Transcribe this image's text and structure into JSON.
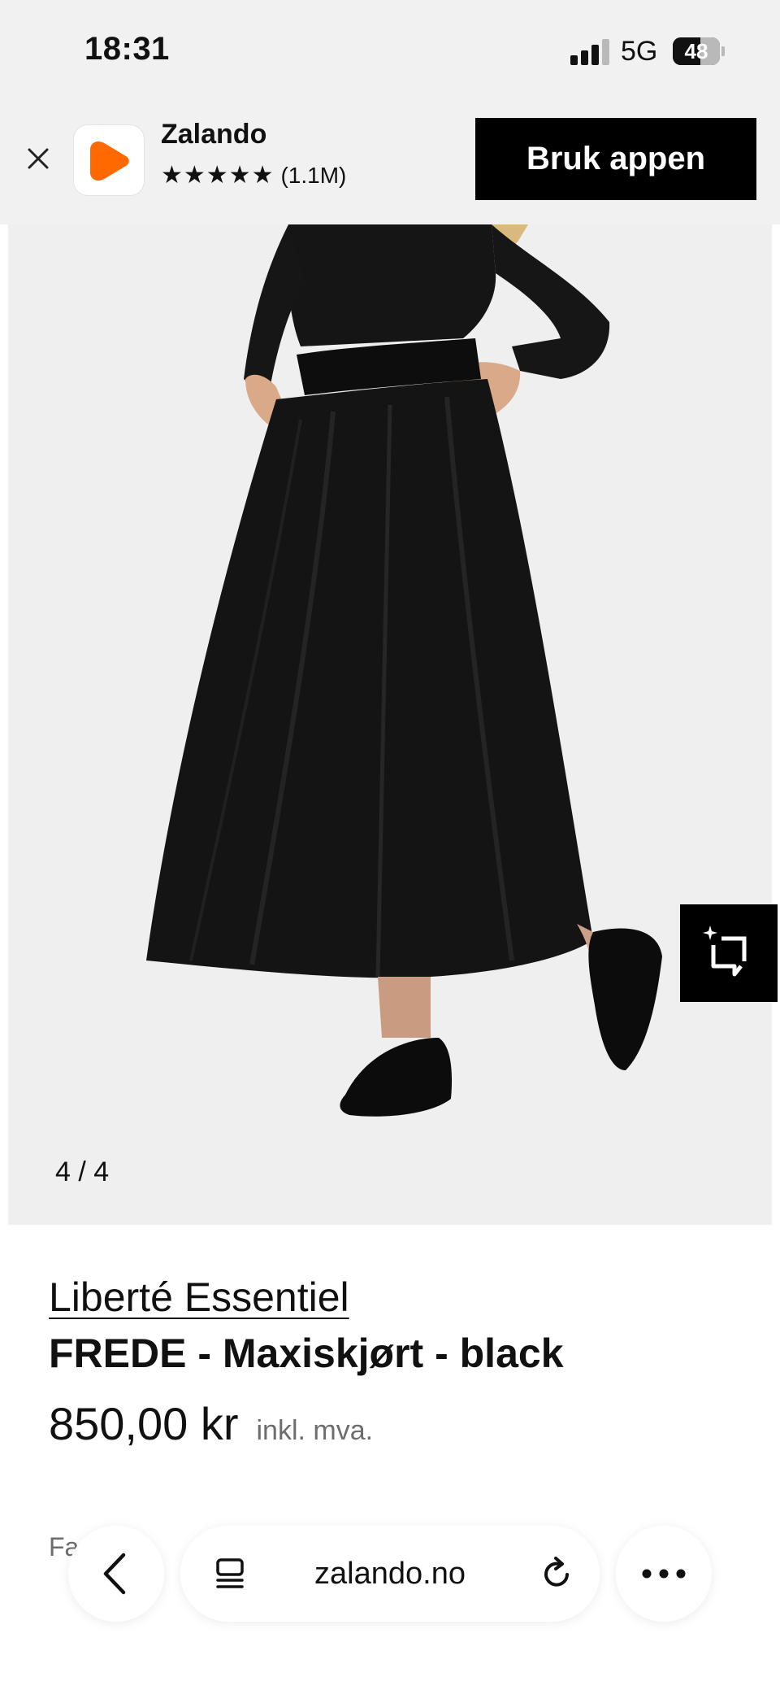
{
  "status_bar": {
    "time": "18:31",
    "network": "5G",
    "battery": "48",
    "battery_level_percent": 48
  },
  "app_banner": {
    "app_name": "Zalando",
    "stars": "★★★★★",
    "rating_count": "(1.1M)",
    "cta_label": "Bruk appen",
    "brand_color": "#ff6900",
    "close_icon": "close-icon"
  },
  "gallery": {
    "counter": "4 / 4",
    "stylist_icon": "ai-sparkle-crop-icon"
  },
  "product": {
    "brand": "Liberté Essentiel",
    "name": "FREDE - Maxiskjørt - black",
    "price": "850,00 kr",
    "price_note": "inkl. mva.",
    "color_label_partial": "Fa"
  },
  "browser_toolbar": {
    "url": "zalando.no",
    "back_icon": "chevron-left-icon",
    "tabs_icon": "tab-list-icon",
    "reload_icon": "reload-icon",
    "more_icon": "more-dots-icon"
  }
}
